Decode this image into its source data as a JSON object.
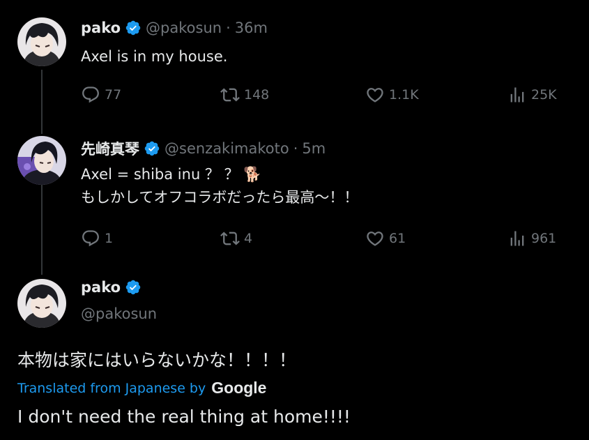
{
  "colors": {
    "background": "#000000",
    "text": "#e7e9ea",
    "muted": "#71767b",
    "verified": "#1d9bf0",
    "link": "#1d9bf0",
    "thread_line": "#333639"
  },
  "tweets": [
    {
      "name": "pako",
      "handle": "@pakosun",
      "separator": "·",
      "time": "36m",
      "lines": [
        "Axel is in my house."
      ],
      "actions": {
        "replies": "77",
        "retweets": "148",
        "likes": "1.1K",
        "views": "25K"
      }
    },
    {
      "name": "先崎真琴",
      "handle": "@senzakimakoto",
      "separator": "·",
      "time": "5m",
      "lines": [
        "Axel = shiba inu ？ ？ 🐕",
        "もしかしてオフコラボだったら最高〜！！"
      ],
      "actions": {
        "replies": "1",
        "retweets": "4",
        "likes": "61",
        "views": "961"
      }
    }
  ],
  "main_tweet": {
    "name": "pako",
    "handle": "@pakosun",
    "text": "本物は家にはいらないかな！！！！",
    "translated_label": "Translated from Japanese by",
    "translator_brand": "Google",
    "translation": "I don't need the real thing at home!!!!"
  },
  "icons": {
    "reply": "reply-icon",
    "retweet": "retweet-icon",
    "like": "heart-icon",
    "views": "views-icon",
    "verified": "verified-badge-icon"
  }
}
